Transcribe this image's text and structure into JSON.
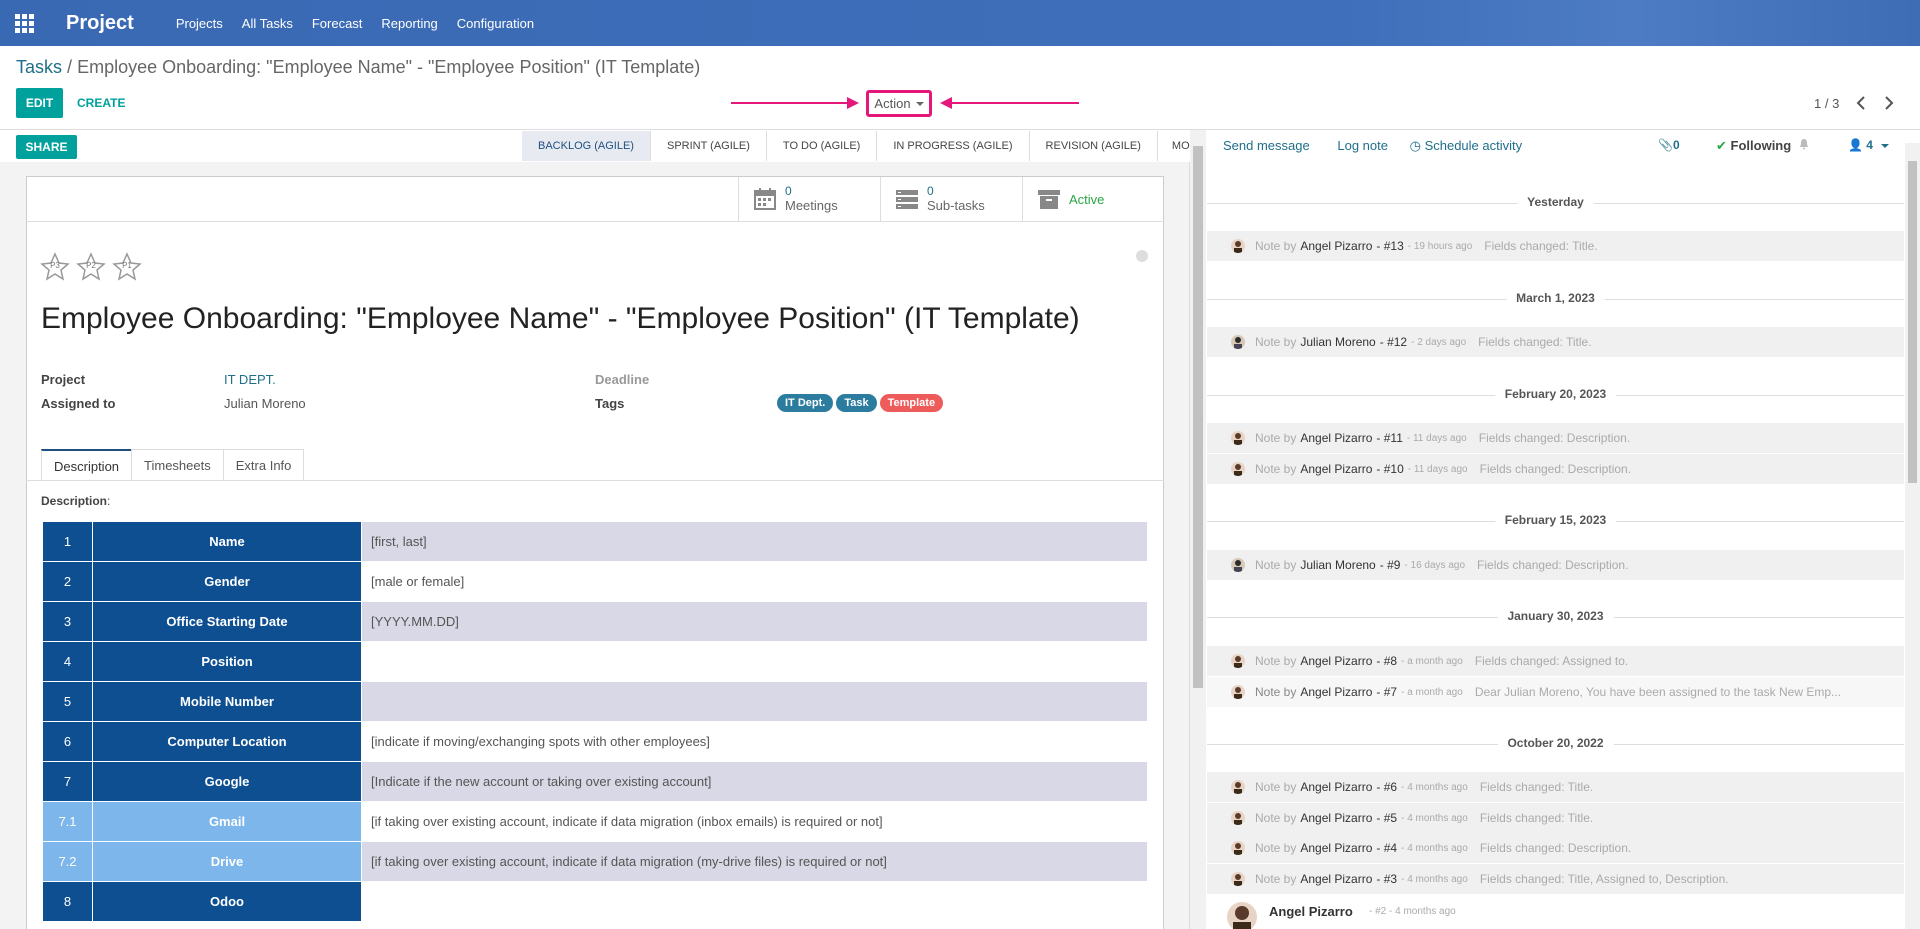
{
  "nav": {
    "brand": "Project",
    "items": [
      "Projects",
      "All Tasks",
      "Forecast",
      "Reporting",
      "Configuration"
    ]
  },
  "breadcrumb": {
    "root": "Tasks",
    "sep": "/",
    "current": "Employee Onboarding: \"Employee Name\" - \"Employee Position\" (IT Template)"
  },
  "toolbar": {
    "edit_label": "EDIT",
    "create_label": "CREATE",
    "action_label": "Action",
    "pager": "1 / 3"
  },
  "statusbar": {
    "share_label": "SHARE",
    "stages": [
      "BACKLOG (AGILE)",
      "SPRINT (AGILE)",
      "TO DO (AGILE)",
      "IN PROGRESS (AGILE)",
      "REVISION (AGILE)"
    ],
    "more_label": "MORE"
  },
  "smart_buttons": {
    "meetings_count": "0",
    "meetings_label": "Meetings",
    "subtasks_count": "0",
    "subtasks_label": "Sub-tasks",
    "active_label": "Active"
  },
  "priority": [
    "P3",
    "P2",
    "P1"
  ],
  "task": {
    "title": "Employee Onboarding: \"Employee Name\" - \"Employee Position\" (IT Template)",
    "project_label": "Project",
    "project_value": "IT DEPT.",
    "assigned_label": "Assigned to",
    "assigned_value": "Julian Moreno",
    "deadline_label": "Deadline",
    "tags_label": "Tags",
    "tags": [
      {
        "label": "IT Dept.",
        "color": "#2c7c9f"
      },
      {
        "label": "Task",
        "color": "#2c7c9f"
      },
      {
        "label": "Template",
        "color": "#ee5b5b"
      }
    ]
  },
  "tabs": [
    "Description",
    "Timesheets",
    "Extra Info"
  ],
  "description_label": "Description",
  "description_colon": ":",
  "onboarding_table": [
    {
      "num": "1",
      "name": "Name",
      "value": "[first, last]"
    },
    {
      "num": "2",
      "name": "Gender",
      "value": "[male or female]"
    },
    {
      "num": "3",
      "name": "Office Starting Date",
      "value": "[YYYY.MM.DD]"
    },
    {
      "num": "4",
      "name": "Position",
      "value": ""
    },
    {
      "num": "5",
      "name": "Mobile Number",
      "value": ""
    },
    {
      "num": "6",
      "name": "Computer Location",
      "value": "[indicate if moving/exchanging spots with other employees]"
    },
    {
      "num": "7",
      "name": "Google",
      "value": "[Indicate if the new account or taking over existing account]"
    },
    {
      "num": "7.1",
      "name": "Gmail",
      "value": "[if taking over existing account, indicate if data migration (inbox emails) is required or not]"
    },
    {
      "num": "7.2",
      "name": "Drive",
      "value": "[if taking over existing account, indicate if data migration (my-drive files) is required or not]"
    },
    {
      "num": "8",
      "name": "Odoo",
      "value": ""
    }
  ],
  "chatter": {
    "send_message": "Send message",
    "log_note": "Log note",
    "schedule_activity": "Schedule activity",
    "attachments": "0",
    "following": "Following",
    "followers": "4",
    "note_prefix": "Note by",
    "dates": [
      "Yesterday",
      "March 1, 2023",
      "February 20, 2023",
      "February 15, 2023",
      "January 30, 2023",
      "October 20, 2022"
    ],
    "notes": [
      {
        "author": "Angel Pizarro",
        "ref": "- #13",
        "ago": "- 19 hours ago",
        "change": "Fields changed: Title."
      },
      {
        "author": "Julian Moreno",
        "ref": "- #12",
        "ago": "- 2 days ago",
        "change": "Fields changed: Title."
      },
      {
        "author": "Angel Pizarro",
        "ref": "- #11",
        "ago": "- 11 days ago",
        "change": "Fields changed: Description."
      },
      {
        "author": "Angel Pizarro",
        "ref": "- #10",
        "ago": "- 11 days ago",
        "change": "Fields changed: Description."
      },
      {
        "author": "Julian Moreno",
        "ref": "- #9",
        "ago": "- 16 days ago",
        "change": "Fields changed: Description."
      },
      {
        "author": "Angel Pizarro",
        "ref": "- #8",
        "ago": "- a month ago",
        "change": "Fields changed: Assigned to."
      },
      {
        "author": "Angel Pizarro",
        "ref": "- #7",
        "ago": "- a month ago",
        "change": "Dear Julian Moreno, You have been assigned to the task New Emp..."
      },
      {
        "author": "Angel Pizarro",
        "ref": "- #6",
        "ago": "- 4 months ago",
        "change": "Fields changed: Title."
      },
      {
        "author": "Angel Pizarro",
        "ref": "- #5",
        "ago": "- 4 months ago",
        "change": "Fields changed: Title."
      },
      {
        "author": "Angel Pizarro",
        "ref": "- #4",
        "ago": "- 4 months ago",
        "change": "Fields changed: Description."
      },
      {
        "author": "Angel Pizarro",
        "ref": "- #3",
        "ago": "- 4 months ago",
        "change": "Fields changed: Title, Assigned to, Description."
      }
    ],
    "last_message": {
      "author": "Angel Pizarro",
      "ago": "- #2 - 4 months ago"
    }
  }
}
